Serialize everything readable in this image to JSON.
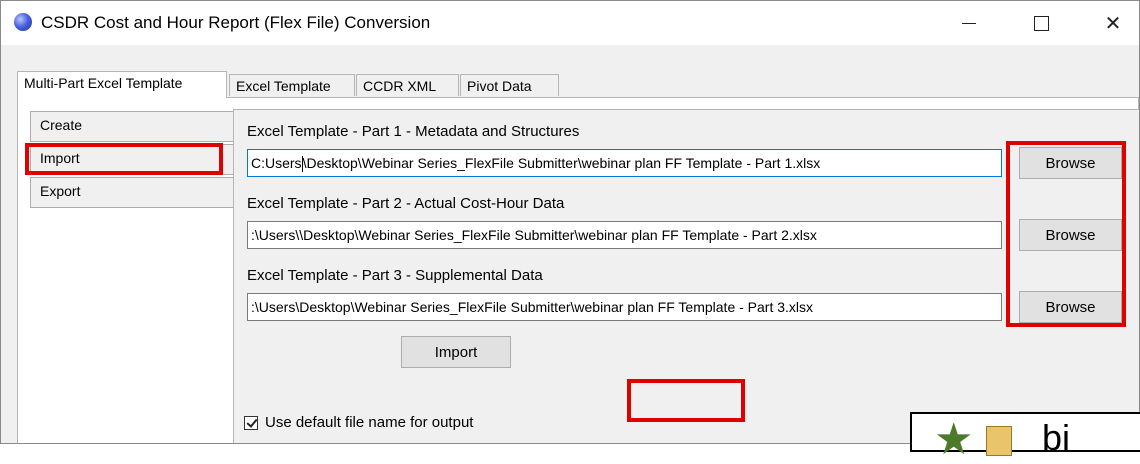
{
  "window": {
    "title": "CSDR Cost and Hour Report (Flex File) Conversion",
    "controls": {
      "minimize": "—",
      "maximize": "☐",
      "close": "✕"
    }
  },
  "tabs": [
    {
      "label": "Multi-Part Excel Template",
      "active": true
    },
    {
      "label": "Excel Template",
      "active": false
    },
    {
      "label": "CCDR XML",
      "active": false
    },
    {
      "label": "Pivot Data",
      "active": false
    }
  ],
  "sidebar": {
    "items": [
      {
        "label": "Create"
      },
      {
        "label": "Import",
        "selected": true
      },
      {
        "label": "Export"
      }
    ]
  },
  "parts": [
    {
      "label": "Excel Template - Part 1 - Metadata and Structures",
      "path_prefix": "C:Users",
      "path_suffix": "\\Desktop\\Webinar Series_FlexFile Submitter\\webinar plan FF Template - Part 1.xlsx",
      "browse": "Browse"
    },
    {
      "label": "Excel Template - Part 2 - Actual Cost-Hour Data",
      "path": ":\\Users\\\\Desktop\\Webinar Series_FlexFile Submitter\\webinar plan FF Template - Part 2.xlsx",
      "browse": "Browse"
    },
    {
      "label": "Excel Template - Part 3 - Supplemental Data",
      "path": ":\\Users\\Desktop\\Webinar Series_FlexFile Submitter\\webinar plan FF Template - Part 3.xlsx",
      "browse": "Browse"
    }
  ],
  "import_button": "Import",
  "use_default_name": {
    "label": "Use default file name for output",
    "checked": true
  },
  "highlight_color": "#e00000",
  "overlay_text": "bi"
}
